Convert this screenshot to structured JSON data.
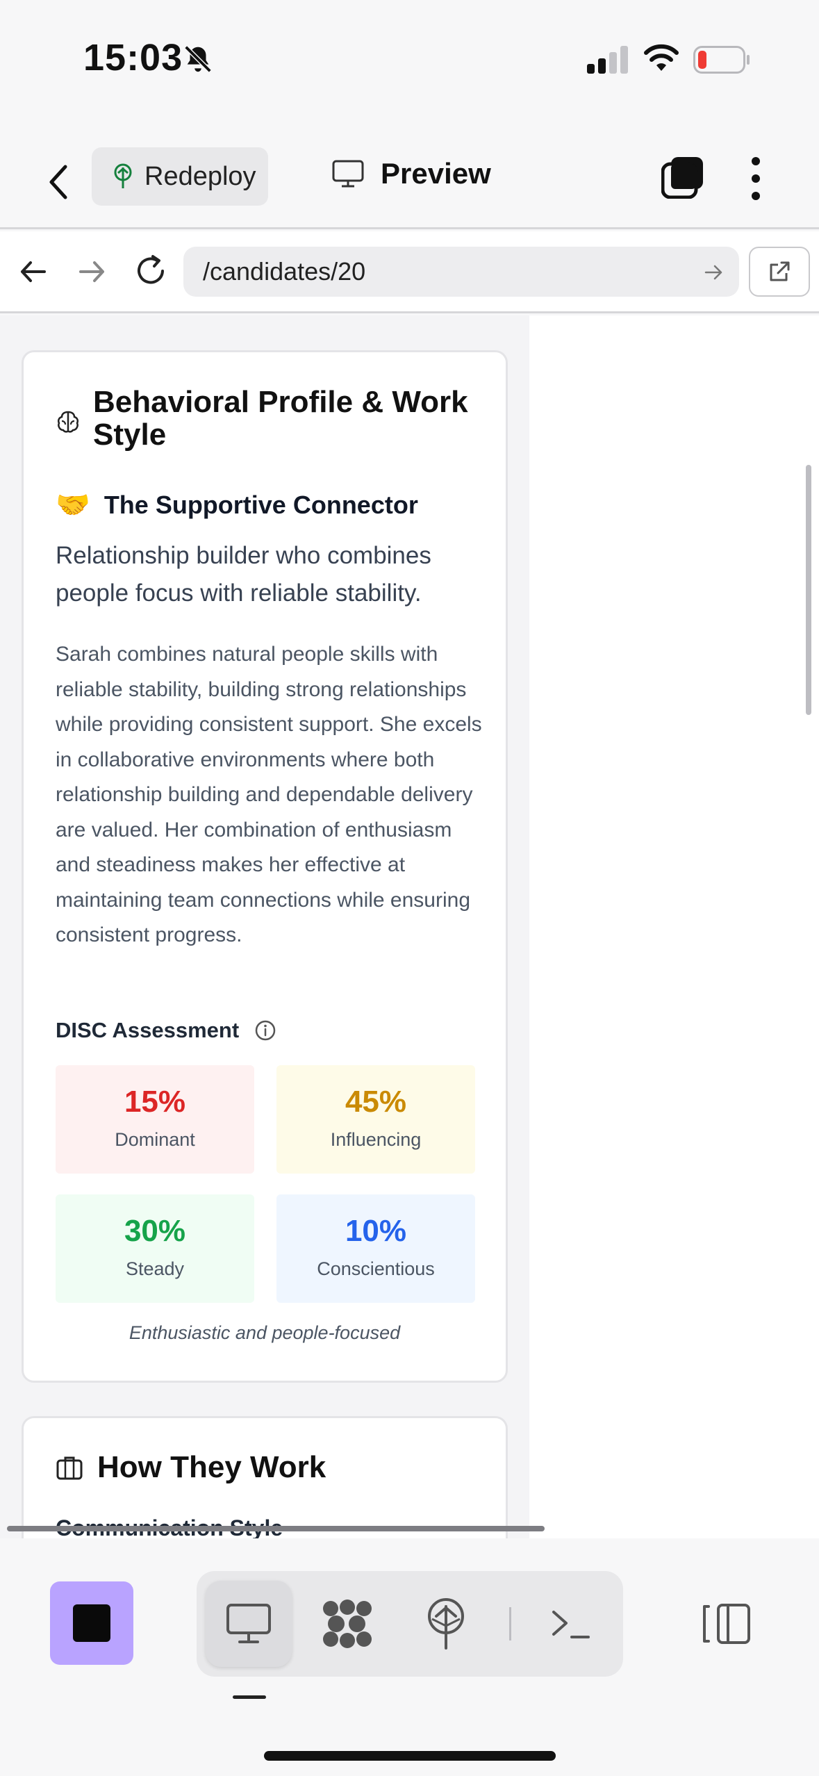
{
  "status": {
    "time": "15:03"
  },
  "app_bar": {
    "redeploy_label": "Redeploy",
    "preview_label": "Preview"
  },
  "browser": {
    "url": "/candidates/20"
  },
  "behavior_card": {
    "title": "Behavioral Profile & Work Style",
    "profile_emoji": "🤝",
    "profile_name": "The Supportive Connector",
    "tagline": "Relationship builder who combines people focus with reliable stability.",
    "summary": "Sarah combines natural people skills with reliable stability, building strong relationships while providing consistent support. She excels in collaborative environments where both relationship building and dependable delivery are valued. Her combination of enthusiasm and steadiness makes her effective at maintaining team connections while ensuring consistent progress.",
    "disc_heading": "DISC Assessment",
    "disc": [
      {
        "percent": "15%",
        "label": "Dominant"
      },
      {
        "percent": "45%",
        "label": "Influencing"
      },
      {
        "percent": "30%",
        "label": "Steady"
      },
      {
        "percent": "10%",
        "label": "Conscientious"
      }
    ],
    "disc_caption": "Enthusiastic and people-focused"
  },
  "how_they_work": {
    "title": "How They Work",
    "subheading": "Communication Style"
  },
  "colors": {
    "accent_purple": "#b9a3ff",
    "redeploy_green": "#15803d",
    "dominant": "#dc2626",
    "influencing": "#ca8a04",
    "steady": "#16a34a",
    "conscientious": "#2563eb"
  },
  "icons": {
    "status": [
      "bell-off-icon",
      "signal-icon",
      "wifi-icon",
      "battery-low-icon"
    ],
    "toolbar": [
      "desktop-icon",
      "grid-blob-icon",
      "deploy-tree-icon",
      "terminal-icon",
      "split-panel-icon"
    ]
  }
}
